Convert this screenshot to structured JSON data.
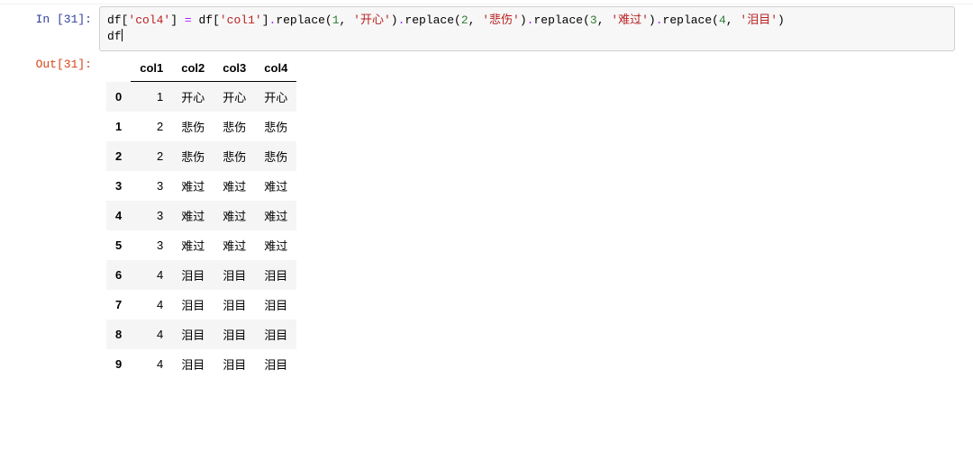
{
  "cell": {
    "in_prompt": "In  [31]:",
    "out_prompt": "Out[31]:",
    "code": {
      "assign_target_open": "df[",
      "assign_target_key": "'col4'",
      "assign_target_close": "]",
      "space1": " ",
      "op_eq": "=",
      "space2": " ",
      "src_open": "df[",
      "src_key": "'col1'",
      "src_close": "]",
      "chain": [
        {
          "dot": ".",
          "fn": "replace",
          "open": "(",
          "num": "1",
          "comma": ", ",
          "str": "'开心'",
          "close": ")"
        },
        {
          "dot": ".",
          "fn": "replace",
          "open": "(",
          "num": "2",
          "comma": ", ",
          "str": "'悲伤'",
          "close": ")"
        },
        {
          "dot": ".",
          "fn": "replace",
          "open": "(",
          "num": "3",
          "comma": ", ",
          "str": "'难过'",
          "close": ")"
        },
        {
          "dot": ".",
          "fn": "replace",
          "open": "(",
          "num": "4",
          "comma": ", ",
          "str": "'泪目'",
          "close": ")"
        }
      ],
      "line2": "df"
    }
  },
  "dataframe": {
    "columns": [
      "col1",
      "col2",
      "col3",
      "col4"
    ],
    "index": [
      "0",
      "1",
      "2",
      "3",
      "4",
      "5",
      "6",
      "7",
      "8",
      "9"
    ],
    "rows": [
      [
        "1",
        "开心",
        "开心",
        "开心"
      ],
      [
        "2",
        "悲伤",
        "悲伤",
        "悲伤"
      ],
      [
        "2",
        "悲伤",
        "悲伤",
        "悲伤"
      ],
      [
        "3",
        "难过",
        "难过",
        "难过"
      ],
      [
        "3",
        "难过",
        "难过",
        "难过"
      ],
      [
        "3",
        "难过",
        "难过",
        "难过"
      ],
      [
        "4",
        "泪目",
        "泪目",
        "泪目"
      ],
      [
        "4",
        "泪目",
        "泪目",
        "泪目"
      ],
      [
        "4",
        "泪目",
        "泪目",
        "泪目"
      ],
      [
        "4",
        "泪目",
        "泪目",
        "泪目"
      ]
    ]
  }
}
